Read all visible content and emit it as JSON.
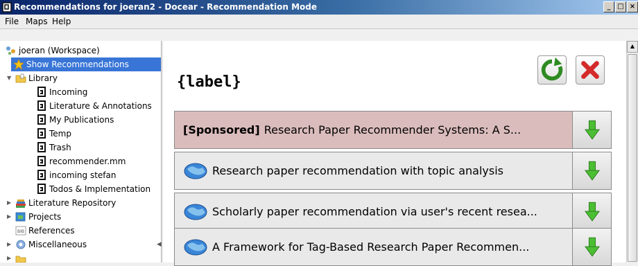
{
  "window": {
    "title": "Recommendations for joeran2 - Docear - Recommendation Mode",
    "min_glyph": "_",
    "max_glyph": "□",
    "close_glyph": "×"
  },
  "menu": [
    "File",
    "Maps",
    "Help"
  ],
  "tree": {
    "items": [
      {
        "label": "joeran (Workspace)",
        "icon": "workspace-icon"
      },
      {
        "label": "Show Recommendations",
        "icon": "star-icon"
      },
      {
        "label": "Library",
        "icon": "library-folder-icon"
      },
      {
        "label": "Incoming",
        "icon": "document-icon"
      },
      {
        "label": "Literature & Annotations",
        "icon": "document-icon"
      },
      {
        "label": "My Publications",
        "icon": "document-icon"
      },
      {
        "label": "Temp",
        "icon": "document-icon"
      },
      {
        "label": "Trash",
        "icon": "document-icon"
      },
      {
        "label": "recommender.mm",
        "icon": "document-icon"
      },
      {
        "label": "incoming stefan",
        "icon": "document-icon"
      },
      {
        "label": "Todos & Implementation",
        "icon": "document-icon"
      },
      {
        "label": "Literature Repository",
        "icon": "books-icon"
      },
      {
        "label": "Projects",
        "icon": "projects-icon"
      },
      {
        "label": "References",
        "icon": "bibtex-icon"
      },
      {
        "label": "Miscellaneous",
        "icon": "misc-icon"
      }
    ]
  },
  "panel": {
    "heading": "{label}",
    "refresh_icon": "refresh-icon",
    "close_icon": "close-icon"
  },
  "recommendations": [
    {
      "prefix": "[Sponsored]",
      "title": "Research Paper Recommender Systems: A S...",
      "sponsored": true
    },
    {
      "prefix": "",
      "title": "Research paper recommendation with topic analysis",
      "sponsored": false
    },
    {
      "prefix": "",
      "title": "Scholarly paper recommendation via user's recent resea...",
      "sponsored": false
    },
    {
      "prefix": "",
      "title": "A Framework for Tag-Based Research Paper Recommen...",
      "sponsored": false
    }
  ],
  "colors": {
    "sponsored_bg": "#dbbcbc",
    "normal_bg": "#e9e9ea",
    "selected_bg": "#3875d7"
  }
}
